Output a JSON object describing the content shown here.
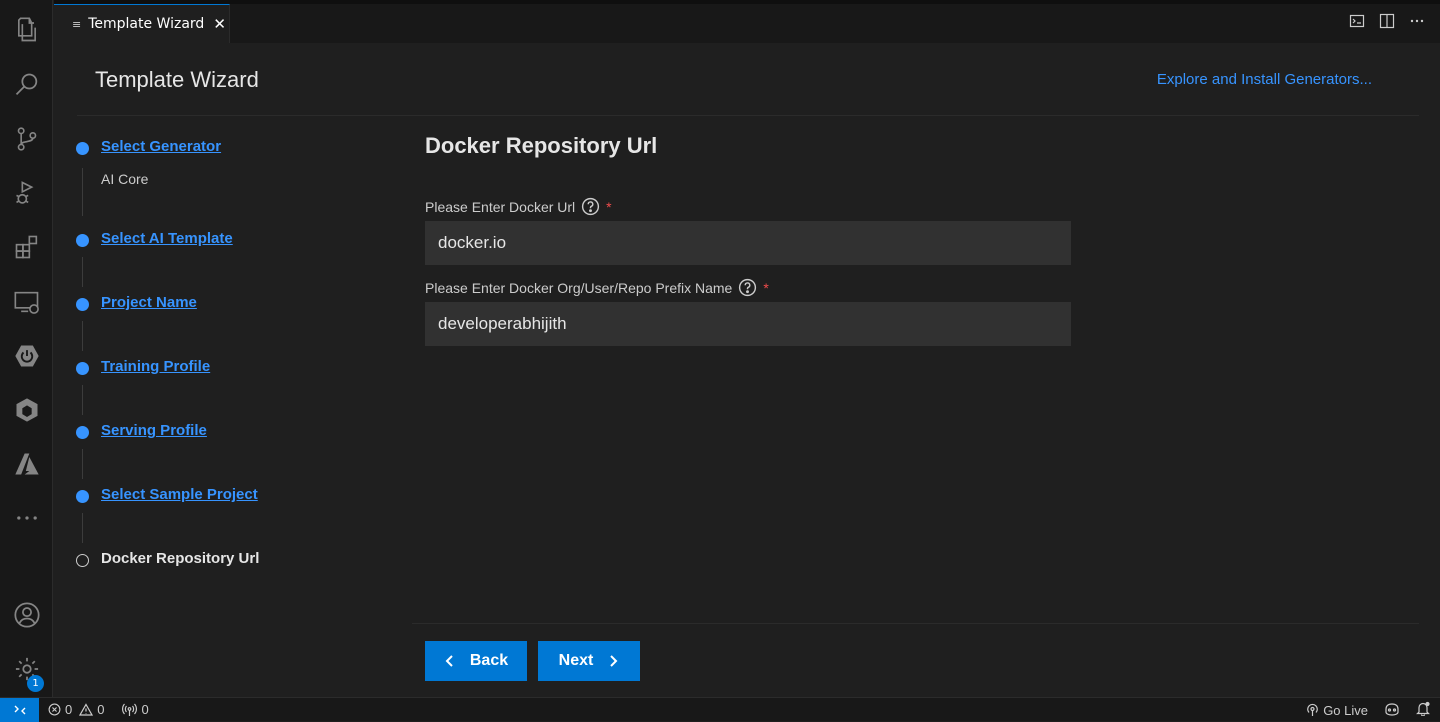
{
  "tab": {
    "title": "Template Wizard",
    "close_glyph": "✕",
    "icon": "≡"
  },
  "header": {
    "title": "Template Wizard",
    "explore_link": "Explore and Install Generators..."
  },
  "steps": [
    {
      "label": "Select Generator",
      "sub": "AI Core",
      "state": "done"
    },
    {
      "label": "Select AI Template",
      "sub": "",
      "state": "done"
    },
    {
      "label": "Project Name",
      "sub": "",
      "state": "done"
    },
    {
      "label": "Training Profile",
      "sub": "",
      "state": "done"
    },
    {
      "label": "Serving Profile",
      "sub": "",
      "state": "done"
    },
    {
      "label": "Select Sample Project",
      "sub": "",
      "state": "done"
    },
    {
      "label": "Docker Repository Url",
      "sub": "",
      "state": "current"
    }
  ],
  "form": {
    "title": "Docker Repository Url",
    "fields": [
      {
        "label": "Please Enter Docker Url",
        "required": "*",
        "value": "docker.io"
      },
      {
        "label": "Please Enter Docker Org/User/Repo Prefix Name",
        "required": "*",
        "value": "developerabhijith"
      }
    ]
  },
  "buttons": {
    "back": "Back",
    "next": "Next"
  },
  "status_bar": {
    "errors": "0",
    "warnings": "0",
    "ports": "0",
    "go_live": "Go Live"
  },
  "activity_bar": {
    "accounts_badge": "1",
    "icons": [
      "explorer-icon",
      "search-icon",
      "source-control-icon",
      "run-debug-icon",
      "extensions-icon",
      "remote-explorer-icon",
      "power-icon",
      "ai-core-icon",
      "azure-icon",
      "more-icon",
      "account-icon",
      "settings-gear-icon"
    ]
  },
  "colors": {
    "accent": "#0078d4",
    "link": "#3794ff",
    "required": "#f14c4c"
  }
}
